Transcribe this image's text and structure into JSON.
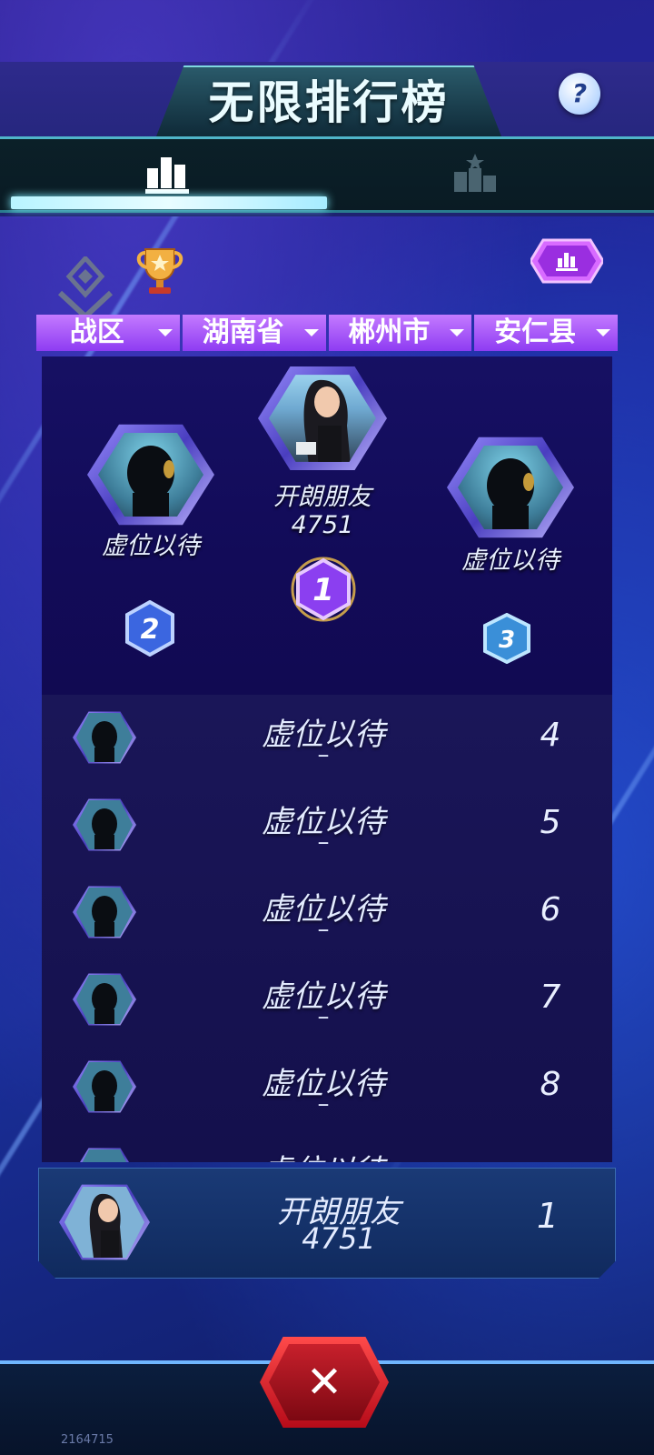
{
  "header": {
    "title": "无限排行榜",
    "help_label": "?",
    "tabs": [
      {
        "name": "tab-ranking",
        "icon": "bar-chart-icon",
        "active": true
      },
      {
        "name": "tab-podium",
        "icon": "podium-stars-icon",
        "active": false
      }
    ]
  },
  "filters": [
    {
      "label": "战区"
    },
    {
      "label": "湖南省"
    },
    {
      "label": "郴州市"
    },
    {
      "label": "安仁县"
    }
  ],
  "podium": {
    "first": {
      "name": "开朗朋友",
      "score": "4751",
      "rank": "1"
    },
    "second": {
      "name": "虚位以待",
      "rank": "2"
    },
    "third": {
      "name": "虚位以待",
      "rank": "3"
    }
  },
  "list": [
    {
      "name": "虚位以待",
      "score": "–",
      "rank": "4"
    },
    {
      "name": "虚位以待",
      "score": "–",
      "rank": "5"
    },
    {
      "name": "虚位以待",
      "score": "–",
      "rank": "6"
    },
    {
      "name": "虚位以待",
      "score": "–",
      "rank": "7"
    },
    {
      "name": "虚位以待",
      "score": "–",
      "rank": "8"
    },
    {
      "name": "虚位以待",
      "score": "",
      "rank": ""
    }
  ],
  "my_entry": {
    "name": "开朗朋友",
    "score": "4751",
    "rank": "1"
  },
  "close_label": "✕",
  "build_id": "2164715",
  "colors": {
    "accent_purple": "#9a4cf5",
    "accent_cyan": "#7ff0ff",
    "close_red": "#c8202c"
  }
}
